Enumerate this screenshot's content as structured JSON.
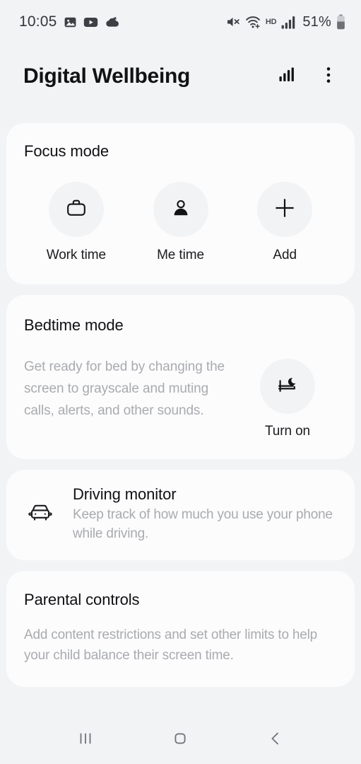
{
  "status_bar": {
    "time": "10:05",
    "left_icons": [
      "gallery-icon",
      "youtube-icon",
      "cloud-upload-icon"
    ],
    "right_icons": [
      "mute-icon",
      "wifi-calling-icon"
    ],
    "network_label": "HD",
    "signal_icon": "signal-bars-icon",
    "battery_percent": "51%",
    "battery_icon": "battery-icon"
  },
  "app_bar": {
    "title": "Digital Wellbeing",
    "actions": [
      {
        "name": "screen-time-chart-icon",
        "label": "Screen time"
      },
      {
        "name": "more-options-icon",
        "label": "More options"
      }
    ]
  },
  "focus_mode": {
    "title": "Focus mode",
    "items": [
      {
        "label": "Work time",
        "icon": "briefcase-icon"
      },
      {
        "label": "Me time",
        "icon": "person-icon"
      },
      {
        "label": "Add",
        "icon": "plus-icon"
      }
    ]
  },
  "bedtime_mode": {
    "title": "Bedtime mode",
    "description": "Get ready for bed by changing the screen to grayscale and muting calls, alerts, and other sounds.",
    "action_label": "Turn on",
    "action_icon": "bed-moon-icon"
  },
  "driving_monitor": {
    "title": "Driving monitor",
    "description": "Keep track of how much you use your phone while driving.",
    "icon": "car-icon"
  },
  "parental_controls": {
    "title": "Parental controls",
    "description": "Add content restrictions and set other limits to help your child balance their screen time."
  },
  "nav_bar": {
    "buttons": [
      {
        "name": "recents-button",
        "label": "Recents"
      },
      {
        "name": "home-button",
        "label": "Home"
      },
      {
        "name": "back-button",
        "label": "Back"
      }
    ]
  },
  "colors": {
    "background": "#f2f3f5",
    "card": "#fcfcfd",
    "primary_text": "#0f1013",
    "secondary_text": "#a9abaf",
    "icon_circle": "#f2f3f5"
  }
}
